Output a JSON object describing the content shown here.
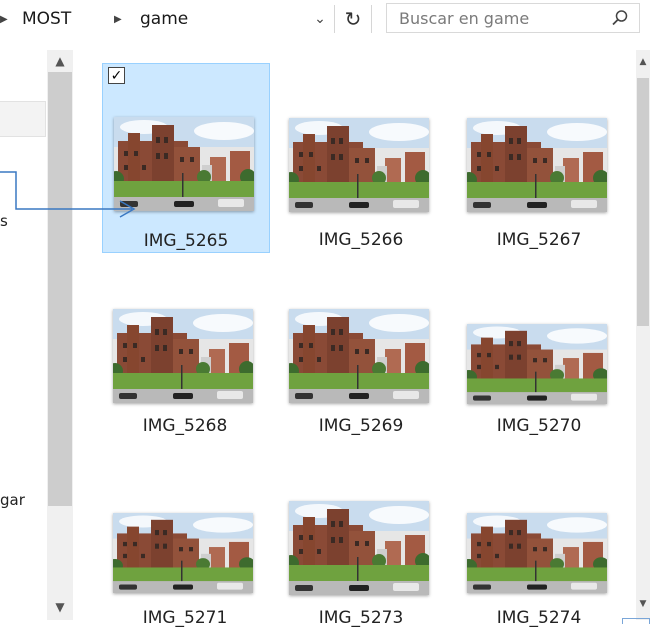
{
  "address_bar": {
    "breadcrumbs": [
      "MOST",
      "game"
    ],
    "separator": "▶",
    "dropdown_glyph": "⌄",
    "refresh_glyph": "↻"
  },
  "search": {
    "placeholder": "Buscar en game",
    "icon": "search-icon"
  },
  "nav_pane": {
    "partial_items": [
      "s",
      "gar"
    ]
  },
  "files": [
    {
      "name": "IMG_5265",
      "selected": true,
      "checked": true
    },
    {
      "name": "IMG_5266",
      "selected": false
    },
    {
      "name": "IMG_5267",
      "selected": false
    },
    {
      "name": "IMG_5268",
      "selected": false
    },
    {
      "name": "IMG_5269",
      "selected": false
    },
    {
      "name": "IMG_5270",
      "selected": false
    },
    {
      "name": "IMG_5271",
      "selected": false
    },
    {
      "name": "IMG_5273",
      "selected": false
    },
    {
      "name": "IMG_5274",
      "selected": false
    }
  ],
  "colors": {
    "selection_fill": "#cce8ff",
    "selection_border": "#99d1ff",
    "callout_arrow": "#3a78c2"
  }
}
